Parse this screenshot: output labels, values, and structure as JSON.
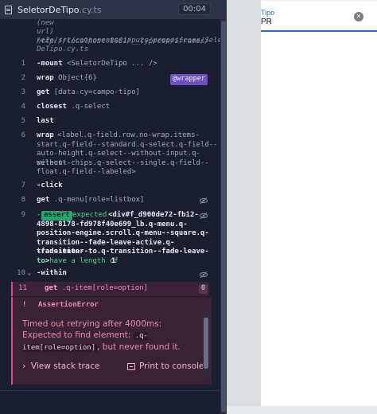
{
  "header": {
    "file_name": "SeletorDeTipo",
    "file_ext": ".cy.ts",
    "timer": "00:04"
  },
  "log": {
    "url_text": [
      "(new",
      "url) http://localhost:8081/__cypress/iframes/",
      "/e2e/src/components/inputs/proposicoes/Seletor",
      "DeTipo.cy.ts"
    ],
    "rows": [
      {
        "num": "1",
        "cmd": "-mount",
        "msg": "<SeletorDeTipo ... />"
      },
      {
        "num": "2",
        "cmd": "wrap",
        "msg": "Object{6}",
        "alias": "@wrapper"
      },
      {
        "num": "3",
        "cmd": "get",
        "msg": "[data-cy=campo-tipo]"
      },
      {
        "num": "4",
        "cmd": "closest",
        "msg": ".q-select"
      },
      {
        "num": "5",
        "cmd": "last",
        "msg": ""
      },
      {
        "num": "6",
        "cmd": "wrap",
        "msg_lines": [
          "<label.q-field.row.no-wrap.items-",
          "start.q-field--standard.q-select.q-field--",
          "auto-height.q-select--without-input.q-select--",
          "without-chips.q-select--single.q-field--",
          "float.q-field--labeled>"
        ]
      },
      {
        "num": "7",
        "cmd": "-click",
        "msg": ""
      },
      {
        "num": "8",
        "cmd": "get",
        "msg": ".q-menu[role=listbox]"
      },
      {
        "num": "9",
        "cmd": "-",
        "assert": "assert",
        "msg_lines": [
          "expected",
          "<div#f_d900de72-fb12-",
          "4898-8178-fd978f40e699_lb.q-menu.q-",
          "position-engine.scroll.q-menu--square.q-",
          "transition--fade-leave-active.q-transition-",
          "-fade-enter-to.q-transition--fade-leave-to>",
          "to have a length of",
          "1"
        ]
      },
      {
        "num": "10",
        "cmd": "-within",
        "msg": ""
      },
      {
        "num": "11",
        "cmd": "get",
        "msg": ".q-item[role=option]",
        "count": "0"
      }
    ]
  },
  "error": {
    "bang": "!",
    "title": "AssertionError",
    "text_before": "Timed out retrying after 4000ms: Expected to find element:",
    "code": ".q-item[role=option]",
    "text_after": ", but never found it.",
    "stack_label": "View stack trace",
    "print_label": "Print to console"
  },
  "app": {
    "field_label": "Tipo",
    "field_value": "PR",
    "clear_symbol": "✕"
  },
  "colors": {
    "accent": "#1976d2",
    "error": "#e0458b",
    "alias": "#6d4fc2",
    "assert": "#1fa971"
  }
}
